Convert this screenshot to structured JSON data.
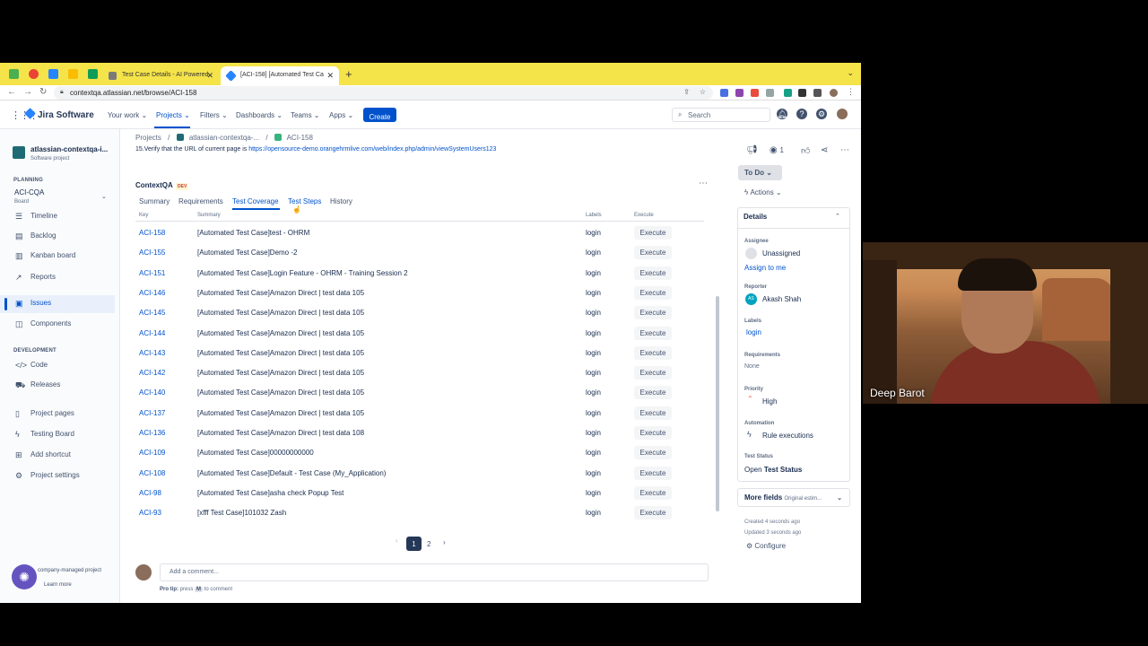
{
  "browser": {
    "tabs": [
      {
        "title": "Test Case Details - AI Powered"
      },
      {
        "title": "[ACI-158] [Automated Test Ca"
      }
    ],
    "url": "contextqa.atlassian.net/browse/ACI-158"
  },
  "topnav": {
    "product": "Jira Software",
    "menu": [
      "Your work",
      "Projects",
      "Filters",
      "Dashboards",
      "Teams",
      "Apps"
    ],
    "create_label": "Create",
    "search_placeholder": "Search"
  },
  "sidebar": {
    "project_name": "atlassian-contextqa-i...",
    "project_type": "Software project",
    "planning_label": "PLANNING",
    "board_name": "ACI-CQA",
    "board_sub": "Board",
    "planning_items": [
      "Timeline",
      "Backlog",
      "Kanban board",
      "Reports"
    ],
    "issues_label": "Issues",
    "components_label": "Components",
    "development_label": "DEVELOPMENT",
    "dev_items": [
      "Code",
      "Releases"
    ],
    "bottom_items": [
      "Project pages",
      "Testing Board",
      "Add shortcut",
      "Project settings"
    ],
    "footer_line1": "company-managed project",
    "footer_line2": "Learn more"
  },
  "breadcrumb": {
    "projects": "Projects",
    "project": "atlassian-contextqa-...",
    "issue": "ACI-158"
  },
  "step15": {
    "text": "15.Verify that the URL of current page is ",
    "link": "https://opensource-demo.orangehrmlive.com/web/index.php/admin/viewSystemUsers123"
  },
  "panel": {
    "title": "ContextQA",
    "badge": "DEV",
    "tabs": [
      "Summary",
      "Requirements",
      "Test Coverage",
      "Test Steps",
      "History"
    ],
    "active_tab": "Test Coverage",
    "columns": [
      "Key",
      "Summary",
      "Labels",
      "Execute"
    ],
    "rows": [
      {
        "key": "ACI-158",
        "summary": "[Automated Test Case]test - OHRM",
        "label": "login",
        "execute": "Execute"
      },
      {
        "key": "ACI-155",
        "summary": "[Automated Test Case]Demo -2",
        "label": "login",
        "execute": "Execute"
      },
      {
        "key": "ACI-151",
        "summary": "[Automated Test Case]Login Feature - OHRM - Training Session 2",
        "label": "login",
        "execute": "Execute"
      },
      {
        "key": "ACI-146",
        "summary": "[Automated Test Case]Amazon Direct | test data 105",
        "label": "login",
        "execute": "Execute"
      },
      {
        "key": "ACI-145",
        "summary": "[Automated Test Case]Amazon Direct | test data 105",
        "label": "login",
        "execute": "Execute"
      },
      {
        "key": "ACI-144",
        "summary": "[Automated Test Case]Amazon Direct | test data 105",
        "label": "login",
        "execute": "Execute"
      },
      {
        "key": "ACI-143",
        "summary": "[Automated Test Case]Amazon Direct | test data 105",
        "label": "login",
        "execute": "Execute"
      },
      {
        "key": "ACI-142",
        "summary": "[Automated Test Case]Amazon Direct | test data 105",
        "label": "login",
        "execute": "Execute"
      },
      {
        "key": "ACI-140",
        "summary": "[Automated Test Case]Amazon Direct | test data 105",
        "label": "login",
        "execute": "Execute"
      },
      {
        "key": "ACI-137",
        "summary": "[Automated Test Case]Amazon Direct | test data 105",
        "label": "login",
        "execute": "Execute"
      },
      {
        "key": "ACI-136",
        "summary": "[Automated Test Case]Amazon Direct | test data 108",
        "label": "login",
        "execute": "Execute"
      },
      {
        "key": "ACI-109",
        "summary": "[Automated Test Case]00000000000",
        "label": "login",
        "execute": "Execute"
      },
      {
        "key": "ACI-108",
        "summary": "[Automated Test Case]Default - Test Case (My_Application)",
        "label": "login",
        "execute": "Execute"
      },
      {
        "key": "ACI-98",
        "summary": "[Automated Test Case]asha check Popup Test",
        "label": "login",
        "execute": "Execute"
      },
      {
        "key": "ACI-93",
        "summary": "[xfff Test Case]101032 Zash",
        "label": "login",
        "execute": "Execute"
      }
    ],
    "pages": [
      "1",
      "2"
    ],
    "current_page": "1"
  },
  "comment": {
    "placeholder": "Add a comment...",
    "protip_prefix": "Pro tip:",
    "protip_mid": " press ",
    "protip_key": "M",
    "protip_suffix": " to comment"
  },
  "right": {
    "watch_count": "1",
    "status": "To Do",
    "actions": "Actions",
    "details_title": "Details",
    "assignee_label": "Assignee",
    "assignee": "Unassigned",
    "assign_to_me": "Assign to me",
    "reporter_label": "Reporter",
    "reporter": "Akash Shah",
    "reporter_initials": "AS",
    "labels_label": "Labels",
    "labels_value": "login",
    "requirements_label": "Requirements",
    "requirements_value": "None",
    "priority_label": "Priority",
    "priority_value": "High",
    "automation_label": "Automation",
    "automation_value": "Rule executions",
    "test_status_label": "Test Status",
    "test_status_prefix": "Open",
    "test_status_value": "Test Status",
    "more_fields": "More fields",
    "more_fields_sub": "Original estim...",
    "created": "Created 4 seconds ago",
    "updated": "Updated 3 seconds ago",
    "configure": "Configure"
  },
  "webcam": {
    "name": "Deep Barot"
  },
  "colors": {
    "accent": "#0052cc",
    "tabstrip": "#f5e34a"
  }
}
